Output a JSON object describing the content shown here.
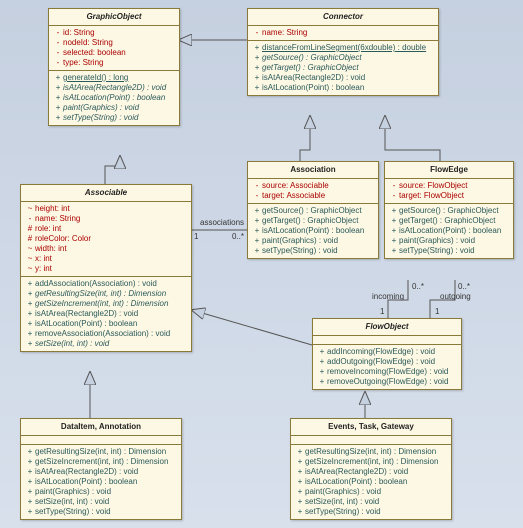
{
  "classes": {
    "GraphicObject": {
      "title": "GraphicObject",
      "attrs": [
        {
          "vis": "-",
          "text": "id: String",
          "cls": "private"
        },
        {
          "vis": "-",
          "text": "nodeId: String",
          "cls": "private"
        },
        {
          "vis": "-",
          "text": "selected: boolean",
          "cls": "private"
        },
        {
          "vis": "-",
          "text": "type: String",
          "cls": "private"
        }
      ],
      "ops": [
        {
          "vis": "+",
          "text": "generateId() : long",
          "italic": false,
          "underline": true
        },
        {
          "vis": "+",
          "text": "isAtArea(Rectangle2D) : void",
          "italic": true
        },
        {
          "vis": "+",
          "text": "isAtLocation(Point) : boolean",
          "italic": true
        },
        {
          "vis": "+",
          "text": "paint(Graphics) : void",
          "italic": true
        },
        {
          "vis": "+",
          "text": "setType(String) : void",
          "italic": true
        }
      ]
    },
    "Connector": {
      "title": "Connector",
      "attrs": [
        {
          "vis": "-",
          "text": "name: String",
          "cls": "private"
        }
      ],
      "ops": [
        {
          "vis": "+",
          "text": "distanceFromLineSegment(6xdouble) : double",
          "underline": true
        },
        {
          "vis": "+",
          "text": "getSource() : GraphicObject",
          "italic": true
        },
        {
          "vis": "+",
          "text": "getTarget() : GraphicObject",
          "italic": true
        },
        {
          "vis": "+",
          "text": "isAtArea(Rectangle2D) : void"
        },
        {
          "vis": "+",
          "text": "isAtLocation(Point) : boolean"
        }
      ]
    },
    "Associable": {
      "title": "Associable",
      "attrs": [
        {
          "vis": "~",
          "text": "height: int",
          "cls": "private"
        },
        {
          "vis": "-",
          "text": "name: String",
          "cls": "private"
        },
        {
          "vis": "#",
          "text": "role: int",
          "cls": "protected"
        },
        {
          "vis": "#",
          "text": "roleColor: Color",
          "cls": "protected"
        },
        {
          "vis": "~",
          "text": "width: int",
          "cls": "private"
        },
        {
          "vis": "~",
          "text": "x: int",
          "cls": "private"
        },
        {
          "vis": "~",
          "text": "y: int",
          "cls": "private"
        }
      ],
      "ops": [
        {
          "vis": "+",
          "text": "addAssociation(Association) : void"
        },
        {
          "vis": "+",
          "text": "getResultingSize(int, int) : Dimension",
          "italic": true
        },
        {
          "vis": "+",
          "text": "getSizeIncrement(int, int) : Dimension",
          "italic": true
        },
        {
          "vis": "+",
          "text": "isAtArea(Rectangle2D) : void"
        },
        {
          "vis": "+",
          "text": "isAtLocation(Point) : boolean"
        },
        {
          "vis": "+",
          "text": "removeAssociation(Association) : void"
        },
        {
          "vis": "+",
          "text": "setSize(int, int) : void",
          "italic": true
        }
      ]
    },
    "Association": {
      "title": "Association",
      "attrs": [
        {
          "vis": "-",
          "text": "source: Associable",
          "cls": "private"
        },
        {
          "vis": "-",
          "text": "target: Associable",
          "cls": "private"
        }
      ],
      "ops": [
        {
          "vis": "+",
          "text": "getSource() : GraphicObject"
        },
        {
          "vis": "+",
          "text": "getTarget() : GraphicObject"
        },
        {
          "vis": "+",
          "text": "isAtLocation(Point) : boolean"
        },
        {
          "vis": "+",
          "text": "paint(Graphics) : void"
        },
        {
          "vis": "+",
          "text": "setType(String) : void"
        }
      ]
    },
    "FlowEdge": {
      "title": "FlowEdge",
      "attrs": [
        {
          "vis": "-",
          "text": "source: FlowObject",
          "cls": "private"
        },
        {
          "vis": "-",
          "text": "target: FlowObject",
          "cls": "private"
        }
      ],
      "ops": [
        {
          "vis": "+",
          "text": "getSource() : GraphicObject"
        },
        {
          "vis": "+",
          "text": "getTarget() : GraphicObject"
        },
        {
          "vis": "+",
          "text": "isAtLocation(Point) : boolean"
        },
        {
          "vis": "+",
          "text": "paint(Graphics) : void"
        },
        {
          "vis": "+",
          "text": "setType(String) : void"
        }
      ]
    },
    "FlowObject": {
      "title": "FlowObject",
      "ops": [
        {
          "vis": "+",
          "text": "addIncoming(FlowEdge) : void"
        },
        {
          "vis": "+",
          "text": "addOutgoing(FlowEdge) : void"
        },
        {
          "vis": "+",
          "text": "removeIncoming(FlowEdge) : void"
        },
        {
          "vis": "+",
          "text": "removeOutgoing(FlowEdge) : void"
        }
      ]
    },
    "DataItemAnnotation": {
      "title": "DataItem, Annotation",
      "ops": [
        {
          "vis": "+",
          "text": "getResultingSize(int, int) : Dimension"
        },
        {
          "vis": "+",
          "text": "getSizeIncrement(int, int) : Dimension"
        },
        {
          "vis": "+",
          "text": "isAtArea(Rectangle2D) : void"
        },
        {
          "vis": "+",
          "text": "isAtLocation(Point) : boolean"
        },
        {
          "vis": "+",
          "text": "paint(Graphics) : void"
        },
        {
          "vis": "+",
          "text": "setSize(int, int) : void"
        },
        {
          "vis": "+",
          "text": "setType(String) : void"
        }
      ]
    },
    "EventsTaskGateway": {
      "title": "Events, Task, Gateway",
      "ops": [
        {
          "vis": "+",
          "text": "getResultingSize(int, int) : Dimension"
        },
        {
          "vis": "+",
          "text": "getSizeIncrement(int, int) : Dimension"
        },
        {
          "vis": "+",
          "text": "isAtArea(Rectangle2D) : void"
        },
        {
          "vis": "+",
          "text": "isAtLocation(Point) : boolean"
        },
        {
          "vis": "+",
          "text": "paint(Graphics) : void"
        },
        {
          "vis": "+",
          "text": "setSize(int, int) : void"
        },
        {
          "vis": "+",
          "text": "setType(String) : void"
        }
      ]
    }
  },
  "labels": {
    "associations": "associations",
    "one_a": "1",
    "zero_star_a": "0..*",
    "incoming": "incoming",
    "outgoing": "outgoing",
    "one_b": "1",
    "zero_star_b": "0..*",
    "zero_star_c": "0..*",
    "one_c": "1"
  }
}
